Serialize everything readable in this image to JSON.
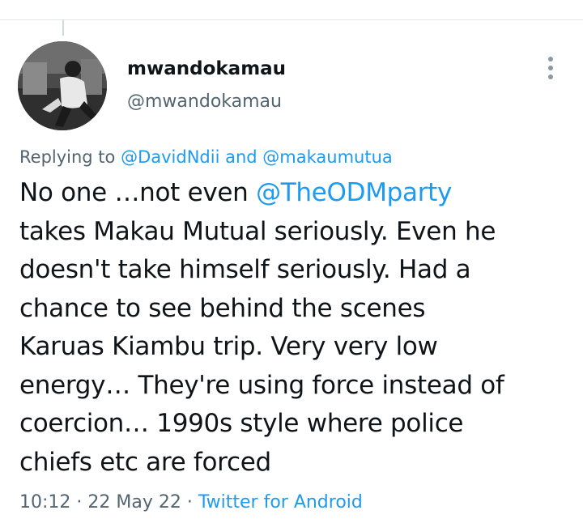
{
  "tweet": {
    "author": {
      "display_name": "mwandokamau",
      "handle": "@mwandokamau"
    },
    "more_icon": "vertical-dots-icon",
    "replying": {
      "prefix": "Replying to ",
      "user1": "@DavidNdii",
      "joiner": " and ",
      "user2": "@makaumutua"
    },
    "text": {
      "line1_prefix": "No one …not even ",
      "line1_mention": "@TheODMparty",
      "line2": "takes Makau Mutual seriously. Even he",
      "line3": "doesn't take himself seriously. Had a",
      "line4": "chance to see behind the scenes",
      "line5": "Karuas Kiambu trip. Very very low",
      "line6": "energy… They're using force instead of",
      "line7": "coercion… 1990s style where police",
      "line8": "chiefs etc are forced"
    },
    "meta": {
      "time": "10:12",
      "sep1": " · ",
      "date": "22 May 22",
      "sep2": " · ",
      "source": "Twitter for Android"
    }
  },
  "colors": {
    "link": "#1d9bf0",
    "secondary_text": "#536471",
    "primary_text": "#0f1419",
    "divider": "#e1e6ea"
  }
}
